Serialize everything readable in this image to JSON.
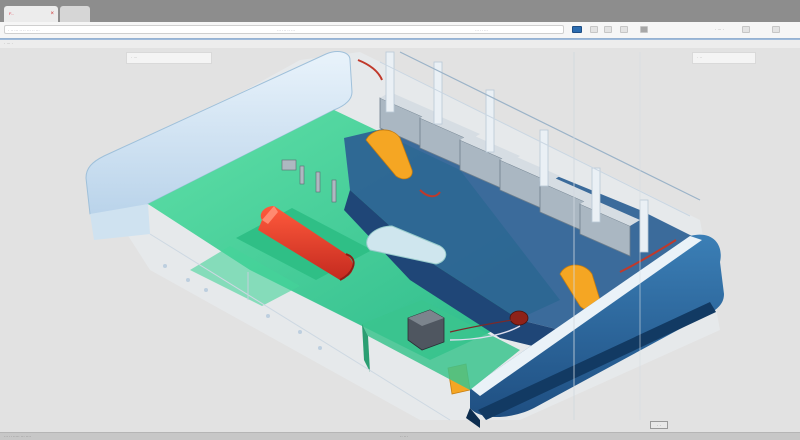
{
  "browser": {
    "tabs": [
      {
        "label": "F..."
      },
      {
        "label": ""
      }
    ],
    "address": "· ·· ··· ·· ·· ··· ·· ···",
    "address_mid": "··· ··· ·· ···",
    "address_right": "··· ·· ···"
  },
  "toolbar": {
    "text": "· ··· ·"
  },
  "subbar": {
    "label": "· ··· ·"
  },
  "viewport": {
    "model": "3D ship engine room model",
    "panel_left_label": "· ···",
    "panel_right_label": "· ··",
    "coord_label": "· ·"
  },
  "status": {
    "left": "··· ·· ····· ··· ····",
    "mid": "·· ···"
  },
  "colors": {
    "deck_green": "#3cc98e",
    "hull_blue": "#2f6ea5",
    "accent_orange": "#f5a623",
    "accent_red": "#d43a2c"
  }
}
